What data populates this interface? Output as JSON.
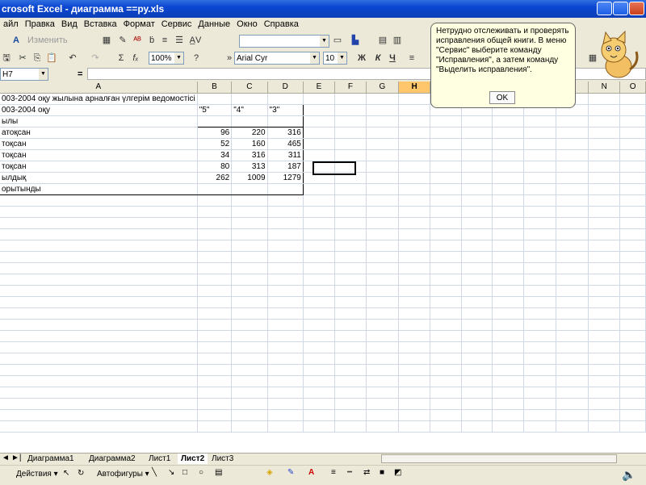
{
  "window": {
    "title": "crosoft Excel - диаграмма ==ру.xls"
  },
  "menu": [
    "айл",
    "Правка",
    "Вид",
    "Вставка",
    "Формат",
    "Сервис",
    "Данные",
    "Окно",
    "Справка"
  ],
  "toolbar1": {
    "edit_text": "Изменить текст..."
  },
  "toolbar2": {
    "zoom": "100%",
    "font": "Arial Cyr",
    "font_size": "10",
    "bold": "Ж",
    "italic": "К",
    "underline": "Ч"
  },
  "formula": {
    "namebox": "H7",
    "equals": "="
  },
  "columns": [
    "A",
    "B",
    "C",
    "D",
    "E",
    "F",
    "G",
    "H",
    "I",
    "J",
    "K",
    "L",
    "M",
    "N",
    "O"
  ],
  "active_column": "H",
  "sheet": {
    "title_row": "003-2004 оқу жылына арналған үлгерім ведомостісі",
    "rows": [
      [
        "003-2004 оқу",
        "\"5\"",
        "\"4\"",
        "\"3\""
      ],
      [
        "ылы",
        "",
        "",
        ""
      ],
      [
        "атоқсан",
        "96",
        "220",
        "316"
      ],
      [
        "тоқсан",
        "52",
        "160",
        "465"
      ],
      [
        "тоқсан",
        "34",
        "316",
        "311"
      ],
      [
        " тоқсан",
        "80",
        "313",
        "187"
      ],
      [
        "ылдық",
        "262",
        "1009",
        "1279"
      ],
      [
        "орытынды",
        "",
        "",
        ""
      ]
    ]
  },
  "tooltip": {
    "text": "Нетрудно отслеживать и проверять исправления общей книги. В меню \"Сервис\" выберите команду \"Исправления\", а затем команду \"Выделить исправления\".",
    "ok": "OK"
  },
  "tabs": [
    "Диаграмма1",
    "Диаграмма2",
    "Лист1",
    "Лист2",
    "Лист3"
  ],
  "active_tab": "Лист2",
  "drawbar": {
    "actions": "Действия ▾",
    "autoshapes": "Автофигуры ▾"
  }
}
